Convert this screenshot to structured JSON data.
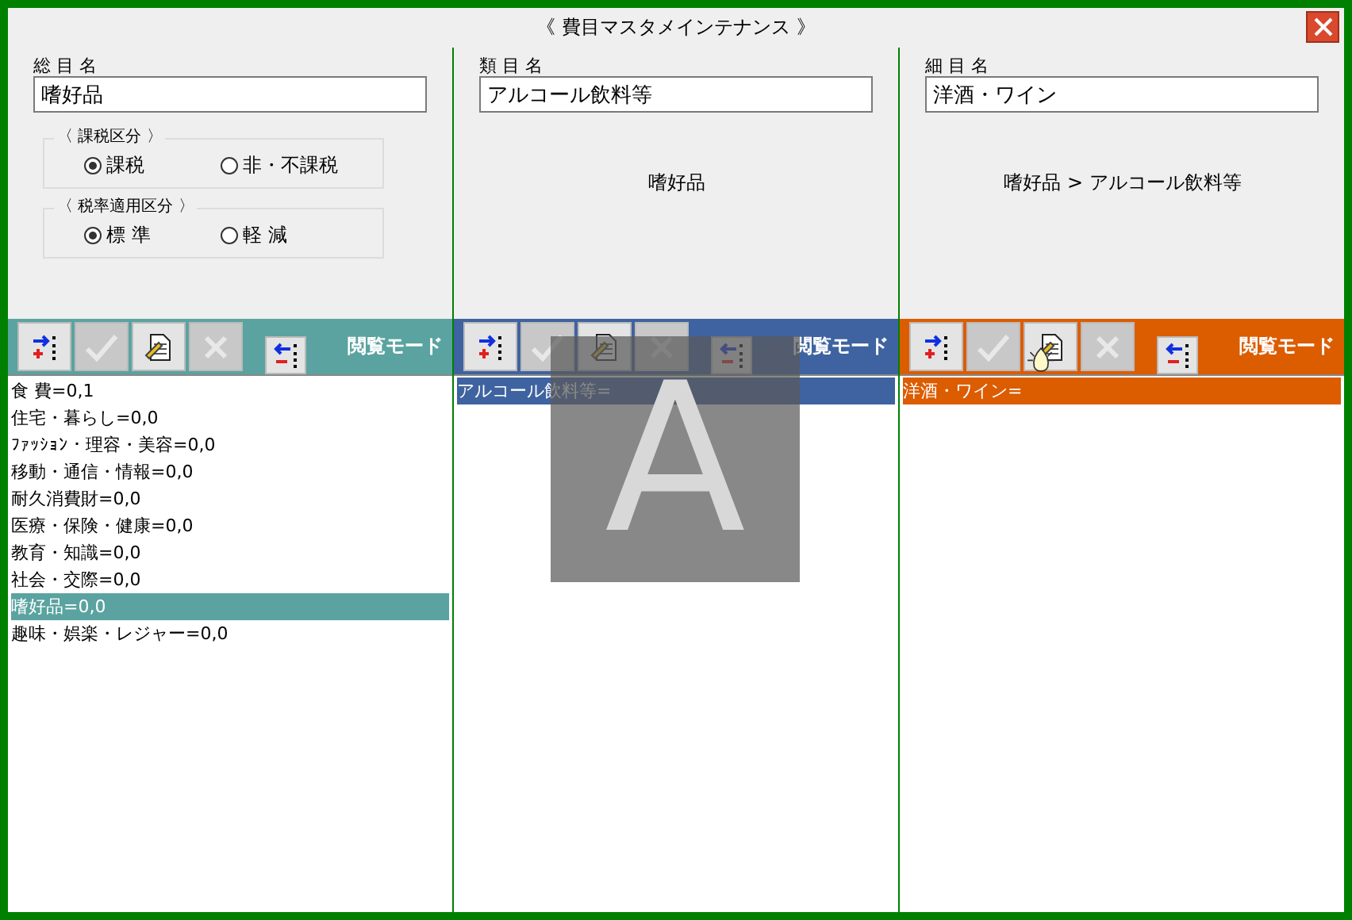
{
  "window": {
    "title": "《 費目マスタメインテナンス 》"
  },
  "panels": [
    {
      "label": "総 目 名",
      "value": "嗜好品",
      "color": "#5aa3a0",
      "tax_groups": [
        {
          "title": "〈 課税区分 〉",
          "options": [
            {
              "label": "課税",
              "selected": true
            },
            {
              "label": "非・不課税",
              "selected": false
            }
          ]
        },
        {
          "title": "〈 税率適用区分 〉",
          "options": [
            {
              "label": "標 準",
              "selected": true
            },
            {
              "label": "軽 減",
              "selected": false
            }
          ]
        }
      ],
      "toolbar": {
        "buttons": [
          {
            "kind": "add",
            "disabled": false
          },
          {
            "kind": "confirm",
            "disabled": true
          },
          {
            "kind": "edit",
            "disabled": false
          },
          {
            "kind": "cancel",
            "disabled": true
          },
          {
            "kind": "remove",
            "disabled": false
          }
        ],
        "mode": "閲覧モード"
      },
      "items": [
        {
          "text": "食 費=0,1",
          "selected": false
        },
        {
          "text": "住宅・暮らし=0,0",
          "selected": false
        },
        {
          "text": "ﾌｧｯｼｮﾝ・理容・美容=0,0",
          "selected": false
        },
        {
          "text": "移動・通信・情報=0,0",
          "selected": false
        },
        {
          "text": "耐久消費財=0,0",
          "selected": false
        },
        {
          "text": "医療・保険・健康=0,0",
          "selected": false
        },
        {
          "text": "教育・知識=0,0",
          "selected": false
        },
        {
          "text": "社会・交際=0,0",
          "selected": false
        },
        {
          "text": "嗜好品=0,0",
          "selected": true
        },
        {
          "text": "趣味・娯楽・レジャー=0,0",
          "selected": false
        }
      ]
    },
    {
      "label": "類 目 名",
      "value": "アルコール飲料等",
      "color": "#3f63a0",
      "breadcrumb": "嗜好品",
      "toolbar": {
        "buttons": [
          {
            "kind": "add",
            "disabled": false
          },
          {
            "kind": "confirm",
            "disabled": true
          },
          {
            "kind": "edit",
            "disabled": false
          },
          {
            "kind": "cancel",
            "disabled": true
          },
          {
            "kind": "remove",
            "disabled": false
          }
        ],
        "mode": "閲覧モード"
      },
      "items": [
        {
          "text": "アルコール飲料等=",
          "selected": true
        }
      ]
    },
    {
      "label": "細 目 名",
      "value": "洋酒・ワイン",
      "color": "#dc5c00",
      "breadcrumb": "嗜好品 > アルコール飲料等",
      "toolbar": {
        "buttons": [
          {
            "kind": "add",
            "disabled": false
          },
          {
            "kind": "confirm",
            "disabled": true
          },
          {
            "kind": "edit",
            "disabled": false
          },
          {
            "kind": "cancel",
            "disabled": true
          },
          {
            "kind": "remove",
            "disabled": false
          }
        ],
        "mode": "閲覧モード"
      },
      "items": [
        {
          "text": "洋酒・ワイン=",
          "selected": true
        }
      ]
    }
  ],
  "ime_indicator": "A"
}
